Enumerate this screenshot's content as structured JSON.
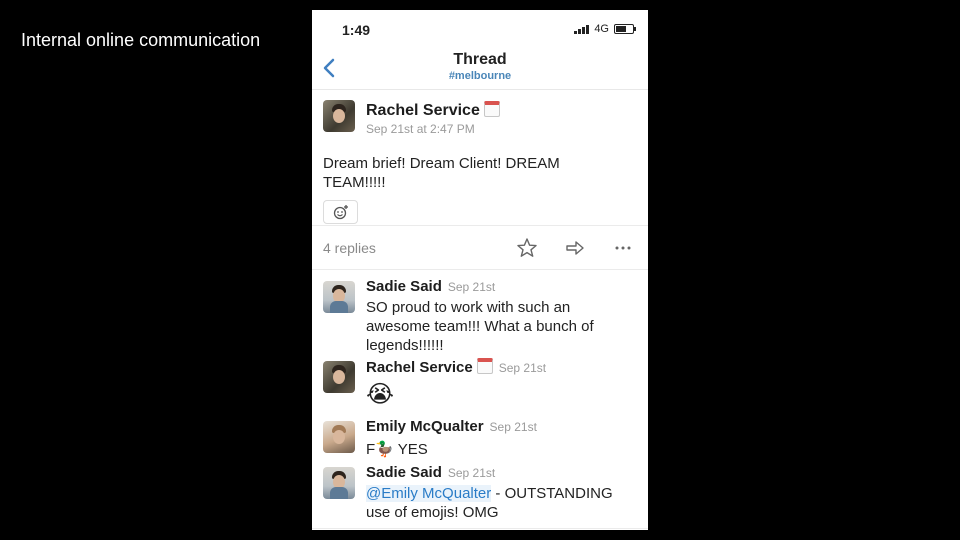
{
  "slide_caption": "Internal online communication",
  "status_bar": {
    "time": "1:49",
    "network": "4G"
  },
  "nav": {
    "title": "Thread",
    "channel": "#melbourne"
  },
  "parent": {
    "author": "Rachel Service",
    "timestamp": "Sep 21st at 2:47 PM",
    "text": "Dream brief! Dream Client! DREAM TEAM!!!!!",
    "replies_count": "4 replies"
  },
  "replies": [
    {
      "author": "Sadie Said",
      "timestamp": "Sep 21st",
      "text": "SO proud to work with such an awesome team!!! What a bunch of legends!!!!!!"
    },
    {
      "author": "Rachel Service",
      "timestamp": "Sep 21st",
      "emoji": "😭"
    },
    {
      "author": "Emily McQualter",
      "timestamp": "Sep 21st",
      "text_prefix": "F",
      "emoji": "🦆",
      "text_suffix": " YES"
    },
    {
      "author": "Sadie Said",
      "timestamp": "Sep 21st",
      "mention": "@Emily McQualter",
      "text": " - OUTSTANDING use of emojis! OMG"
    }
  ],
  "icons": [
    "back-icon",
    "add-reaction-icon",
    "star-icon",
    "share-icon",
    "more-icon",
    "calendar-icon"
  ]
}
